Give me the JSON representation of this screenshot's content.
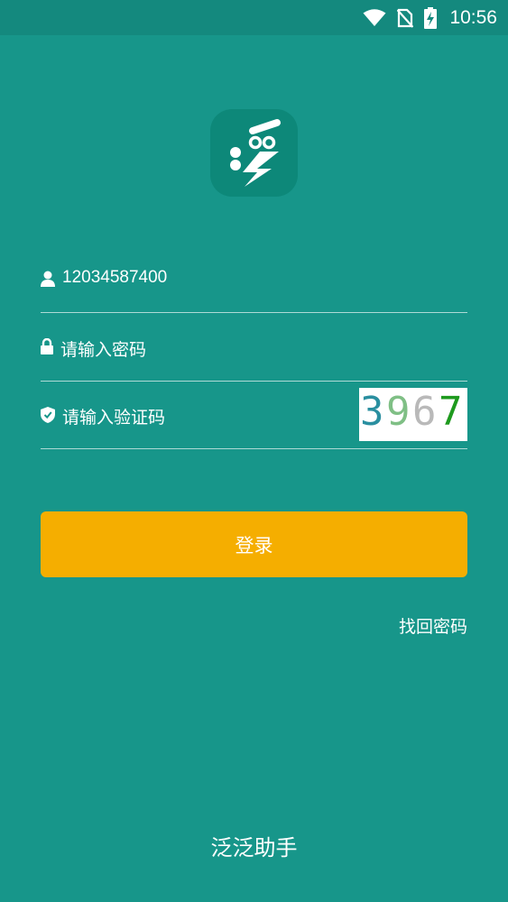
{
  "status_bar": {
    "time": "10:56",
    "icons": [
      "wifi-icon",
      "no-sim-icon",
      "battery-charging-icon"
    ]
  },
  "logo": {
    "icon": "app-logo-icon",
    "background": "#0d8879"
  },
  "form": {
    "username": {
      "value": "12034587400",
      "icon": "user-icon"
    },
    "password": {
      "placeholder": "请输入密码",
      "icon": "lock-icon"
    },
    "captcha": {
      "placeholder": "请输入验证码",
      "icon": "shield-icon",
      "code": [
        "3",
        "9",
        "6",
        "7"
      ],
      "code_colors": [
        "#2a8fa0",
        "#7fbf85",
        "#b9b9b9",
        "#1e9a1e"
      ]
    },
    "login_label": "登录",
    "forgot_label": "找回密码"
  },
  "footer": {
    "app_name": "泛泛助手"
  },
  "colors": {
    "background": "#17968a",
    "status_bar": "#14897e",
    "accent": "#f5ae00"
  }
}
